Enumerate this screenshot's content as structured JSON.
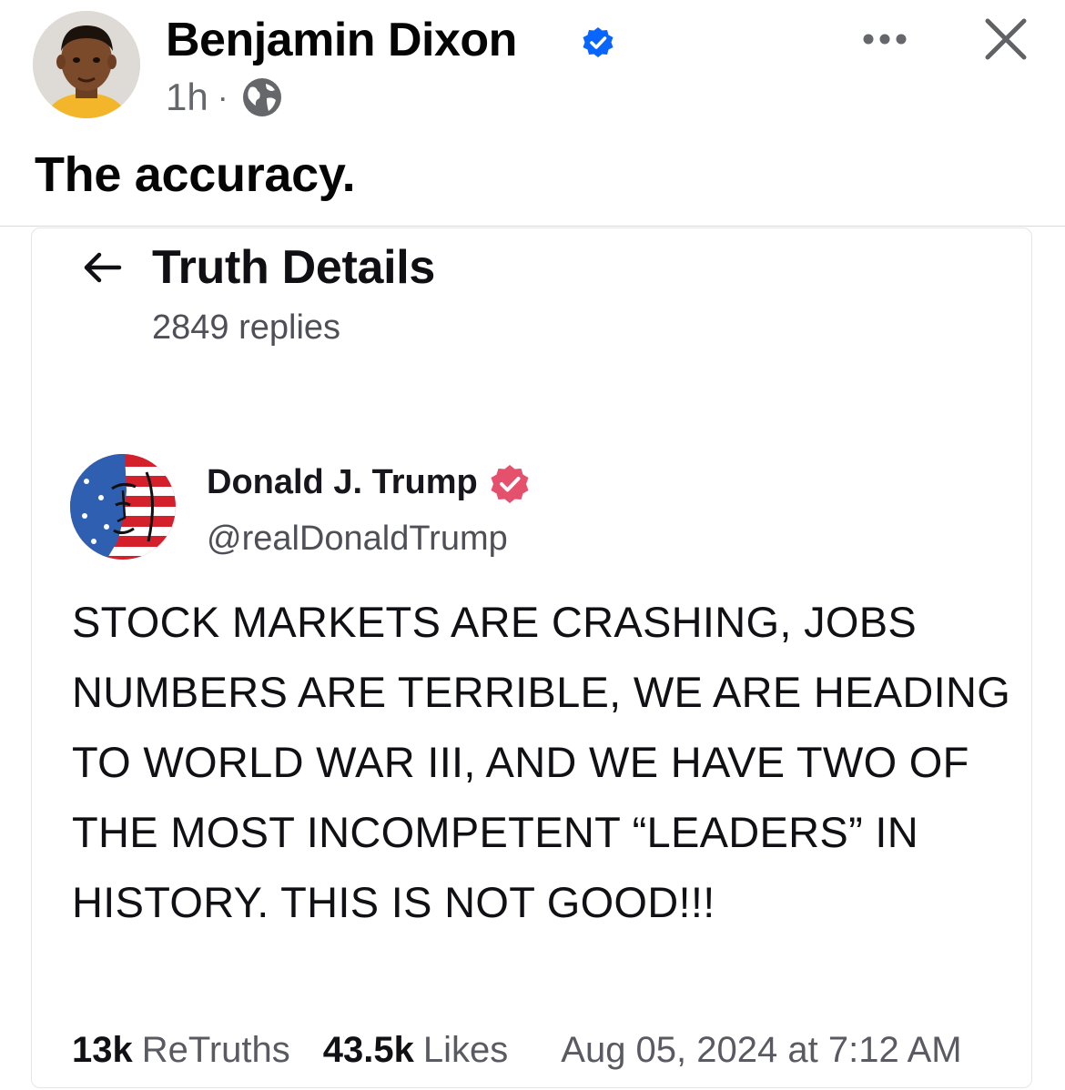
{
  "post": {
    "author": "Benjamin Dixon",
    "time": "1h",
    "separator": "·",
    "caption": "The accuracy.",
    "icons": {
      "verified": "verified-badge-icon",
      "audience": "globe-icon",
      "more": "more-options-icon",
      "close": "close-icon"
    },
    "colors": {
      "verified": "#0866ff",
      "meta": "#65676b"
    }
  },
  "shared_truth": {
    "header_title": "Truth Details",
    "replies": "2849 replies",
    "author_name": "Donald J. Trump",
    "author_handle": "@realDonaldTrump",
    "body": "STOCK MARKETS ARE CRASHING, JOBS NUMBERS ARE TERRIBLE, WE ARE HEADING TO WORLD WAR III, AND WE HAVE TWO OF THE MOST INCOMPETENT “LEADERS” IN HISTORY. THIS IS NOT GOOD!!!",
    "retruths_count": "13k",
    "retruths_label": "ReTruths",
    "likes_count": "43.5k",
    "likes_label": "Likes",
    "date": "Aug 05, 2024 at 7:12 AM",
    "colors": {
      "truth_badge": "#e5506d"
    }
  }
}
